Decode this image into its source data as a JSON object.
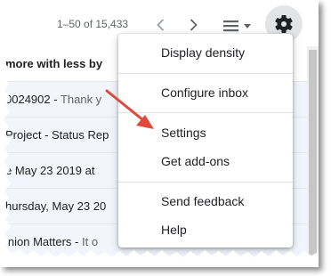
{
  "toolbar": {
    "page_count": "1–50 of 15,433",
    "icons": [
      "chevron-left-icon",
      "chevron-right-icon",
      "density-icon",
      "dropdown-caret-icon",
      "gear-icon"
    ]
  },
  "email_rows": [
    {
      "subject": "more with less by",
      "snippet": "",
      "bold": true,
      "read": false
    },
    {
      "subject": "0024902 -",
      "snippet": " Thank y",
      "bold": false,
      "read": true
    },
    {
      "subject": "Project - Status Rep",
      "snippet": "",
      "bold": false,
      "read": true
    },
    {
      "subject": "e May 23 2019 at",
      "snippet": "",
      "bold": false,
      "read": true
    },
    {
      "subject": "hursday, May 23 20",
      "snippet": "",
      "bold": false,
      "read": true
    },
    {
      "subject": "inion Matters -",
      "snippet": " It o",
      "bold": false,
      "read": true
    }
  ],
  "settings_menu": {
    "items": [
      {
        "label": "Display density"
      },
      {
        "label": "Configure inbox"
      },
      {
        "label": "Settings"
      },
      {
        "label": "Get add-ons"
      },
      {
        "label": "Send feedback"
      },
      {
        "label": "Help"
      }
    ]
  },
  "colors": {
    "arrow": "#e04a3c",
    "icon": "#5f6368",
    "gear_icon": "#202124",
    "gear_button_bg": "#e3e4e6",
    "read_row_bg": "#f2f6fc"
  }
}
